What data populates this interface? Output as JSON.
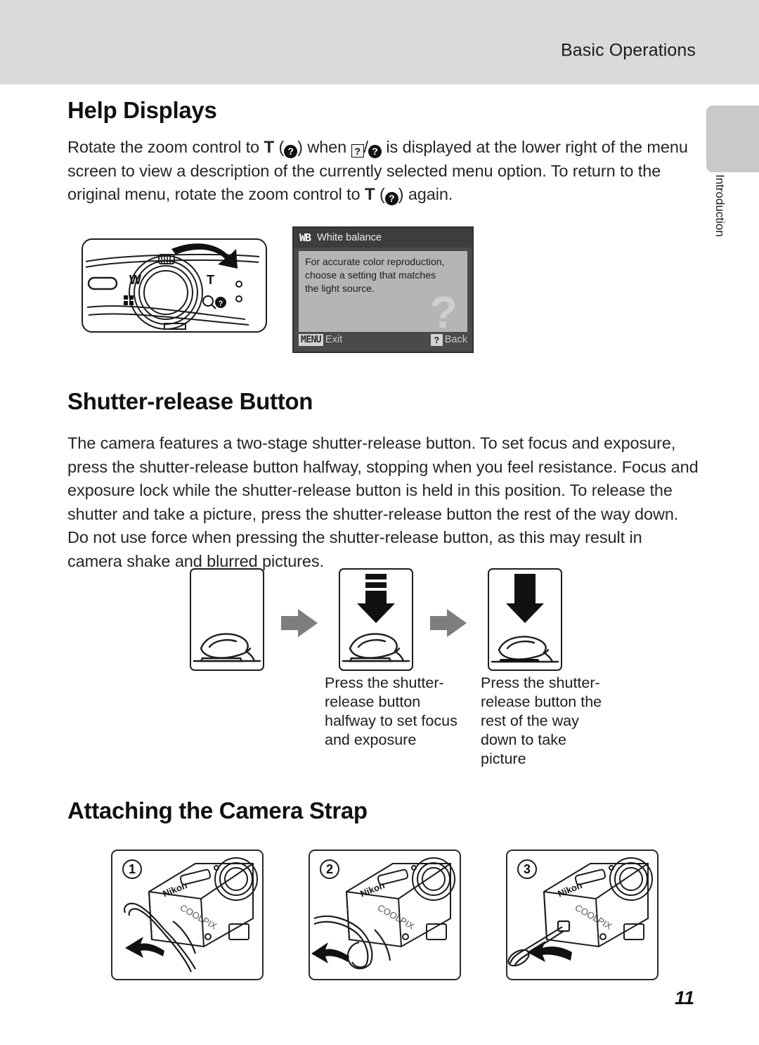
{
  "header": {
    "title": "Basic Operations"
  },
  "side_tab": {
    "label": "Introduction"
  },
  "page_number": "11",
  "sections": {
    "help_displays": {
      "heading": "Help Displays",
      "paragraph_part1": "Rotate the zoom control to ",
      "icon_T_1": "T",
      "paragraph_part2": ") when ",
      "paragraph_part3": " is displayed at the lower right of the menu screen to view a description of the currently selected menu option. To return to the original menu, rotate the zoom control to ",
      "icon_T_2": "T",
      "paragraph_part4": ") again.",
      "qmark_glyph": "?",
      "slash": "/"
    },
    "shutter_release": {
      "heading": "Shutter-release Button",
      "paragraph": "The camera features a two-stage shutter-release button. To set focus and exposure, press the shutter-release button halfway, stopping when you feel resistance. Focus and exposure lock while the shutter-release button is held in this position. To release the shutter and take a picture, press the shutter-release button the rest of the way down. Do not use force when pressing the shutter-release button, as this may result in camera shake and blurred pictures.",
      "captions": [
        "Press the shutter-release button halfway to set focus and exposure",
        "Press the shutter-release button the rest of the way down to take picture"
      ]
    },
    "camera_strap": {
      "heading": "Attaching the Camera Strap",
      "steps": [
        "1",
        "2",
        "3"
      ],
      "brand": "Nikon",
      "model": "COOLPIX"
    }
  },
  "lcd_screen": {
    "title_icon": "WB",
    "title": "White balance",
    "body_lines": [
      "For accurate color reproduction,",
      "choose a setting that matches",
      "the light source."
    ],
    "watermark": "?",
    "bottom_left_badge": "MENU",
    "bottom_left_label": "Exit",
    "bottom_right_badge": "?",
    "bottom_right_label": "Back"
  },
  "camera_top_labels": {
    "wide": "W",
    "tele": "T"
  },
  "colors": {
    "header_band": "#dadada",
    "side_tab": "#c9c9c9",
    "lcd_frame": "#4a4a4a",
    "lcd_titlebar": "#3d3d3d",
    "lcd_panel": "#b5b5b5",
    "arrow_gray": "#808080",
    "text": "#1a1a1a"
  }
}
